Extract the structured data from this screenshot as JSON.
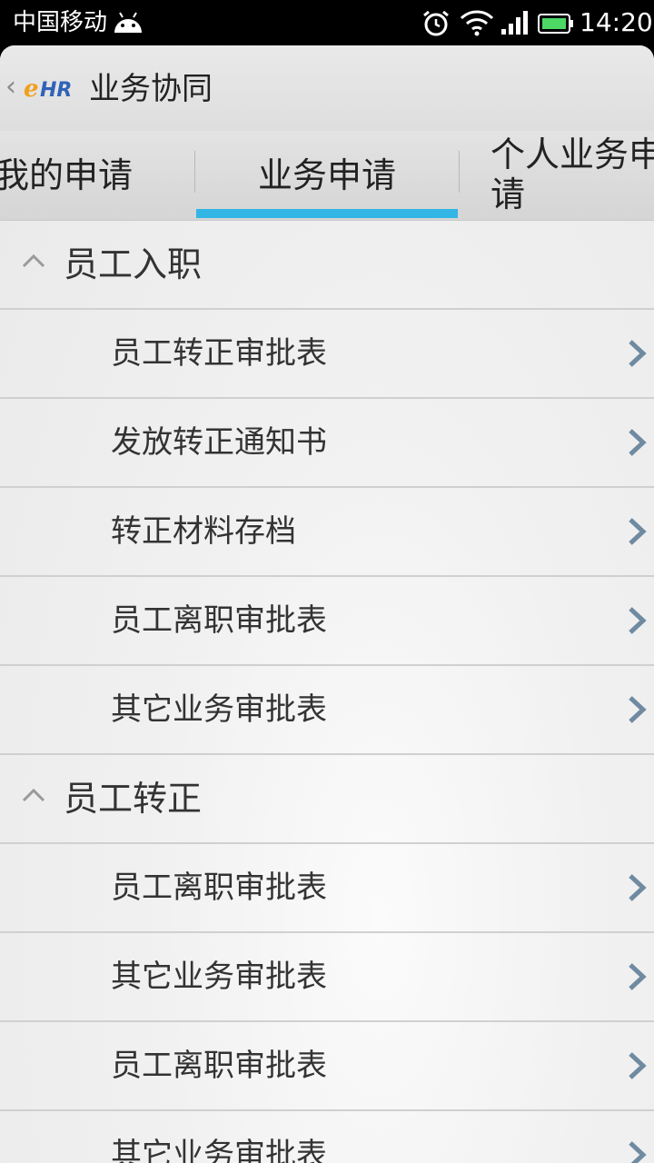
{
  "status_bar": {
    "carrier": "中国移动",
    "time": "14:20",
    "icons": [
      "android-icon",
      "alarm-icon",
      "wifi-icon",
      "signal-icon",
      "battery-icon"
    ]
  },
  "header": {
    "logo_text": "eHR",
    "title": "业务协同"
  },
  "tabs": [
    {
      "label": "我的申请"
    },
    {
      "label": "业务申请",
      "selected": true
    },
    {
      "label": "个人业务申请"
    }
  ],
  "colors": {
    "accent": "#33b5e5",
    "arrow": "#6f8aa1",
    "logo_orange": "#f0a020",
    "logo_blue": "#2f63b8"
  },
  "groups": [
    {
      "title": "员工入职",
      "items": [
        "员工转正审批表",
        "发放转正通知书",
        "转正材料存档",
        "员工离职审批表",
        "其它业务审批表"
      ]
    },
    {
      "title": "员工转正",
      "items": [
        "员工离职审批表",
        "其它业务审批表",
        "员工离职审批表",
        "其它业务审批表"
      ]
    }
  ]
}
